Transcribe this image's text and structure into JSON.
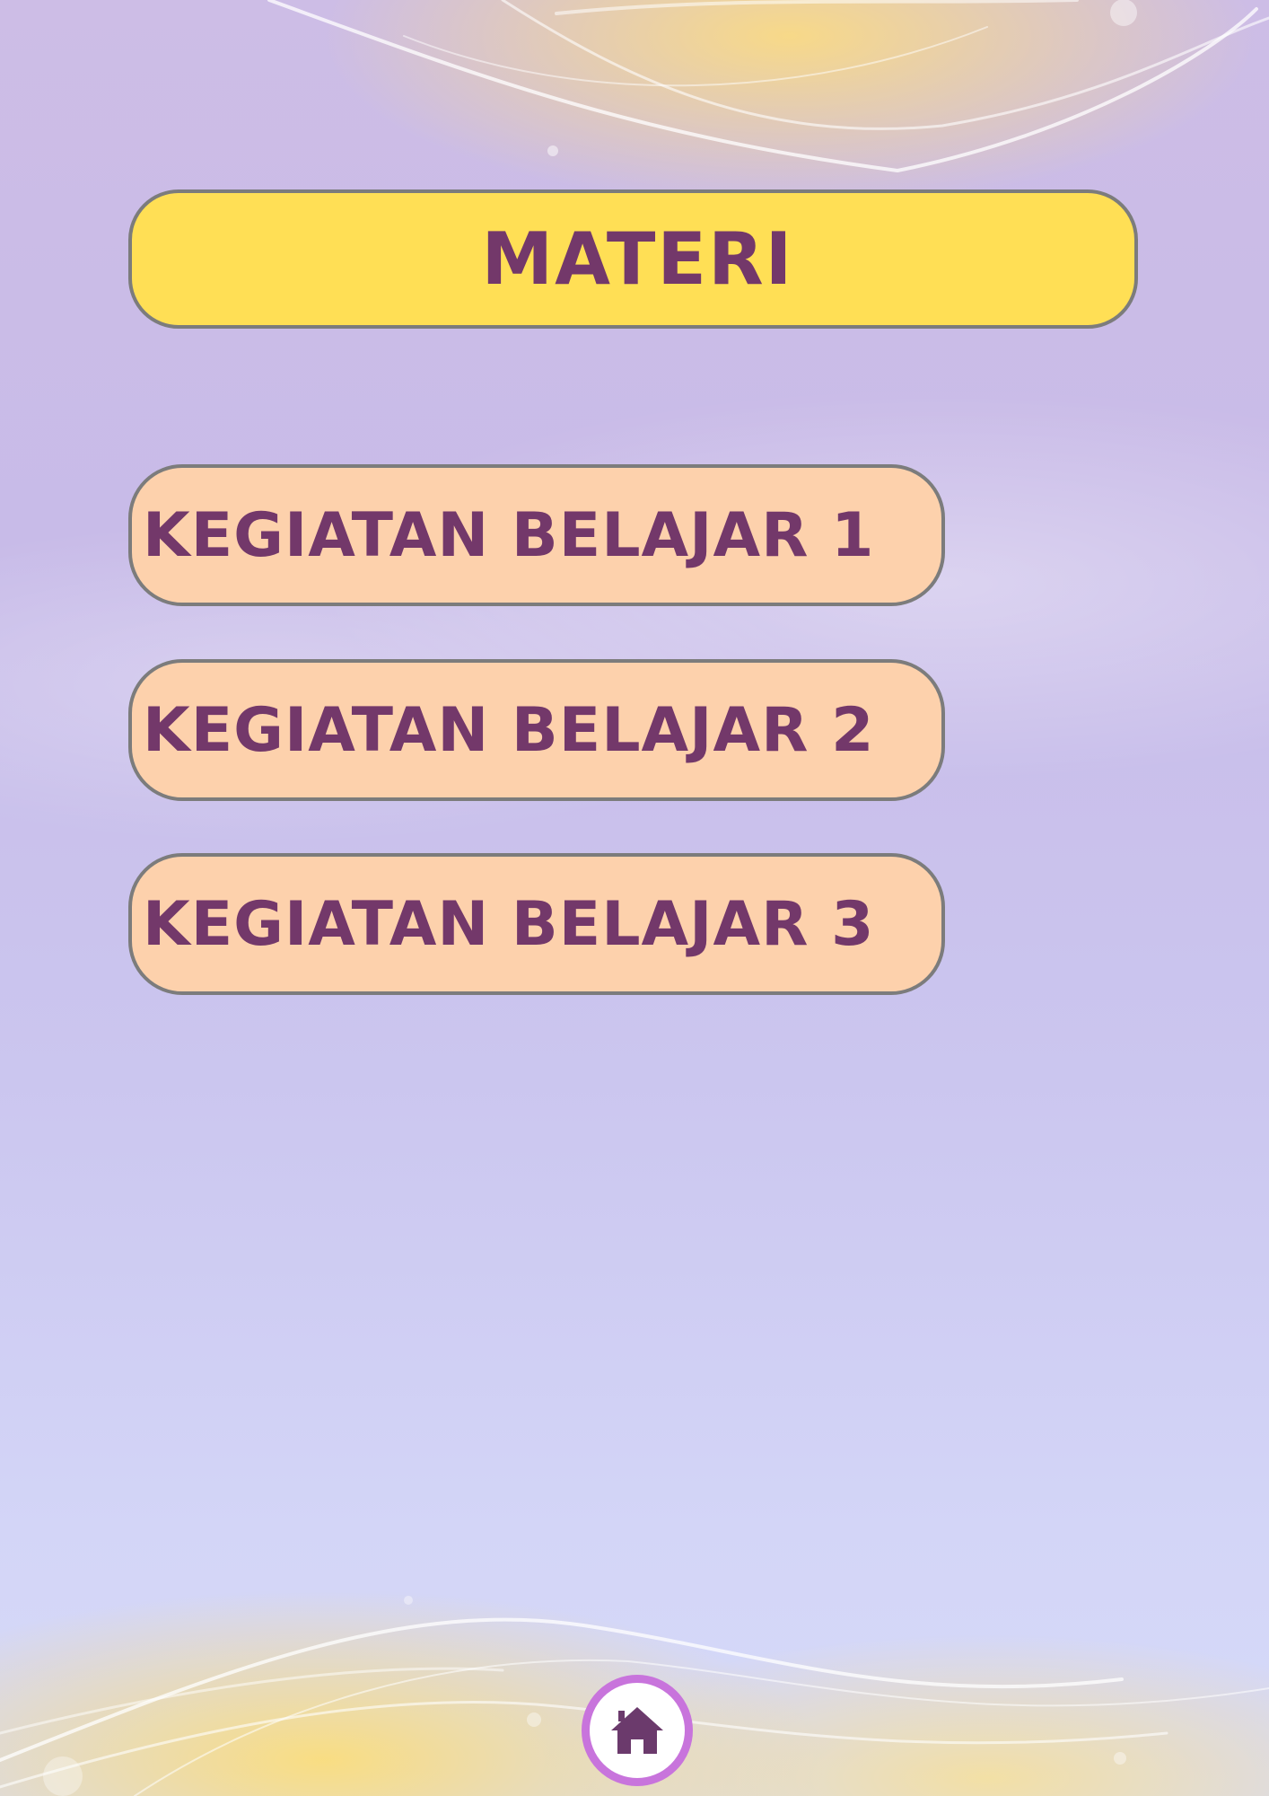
{
  "page": {
    "title": "MATERI"
  },
  "menu": {
    "items": [
      {
        "label": "KEGIATAN BELAJAR 1"
      },
      {
        "label": "KEGIATAN BELAJAR 2"
      },
      {
        "label": "KEGIATAN BELAJAR 3"
      }
    ]
  },
  "nav": {
    "home_icon": "home-icon"
  },
  "colors": {
    "title_background": "#ffdf55",
    "button_background": "#fdd1ac",
    "text": "#73386a",
    "border": "#7c7c7c",
    "home_ring": "#c874dc"
  }
}
